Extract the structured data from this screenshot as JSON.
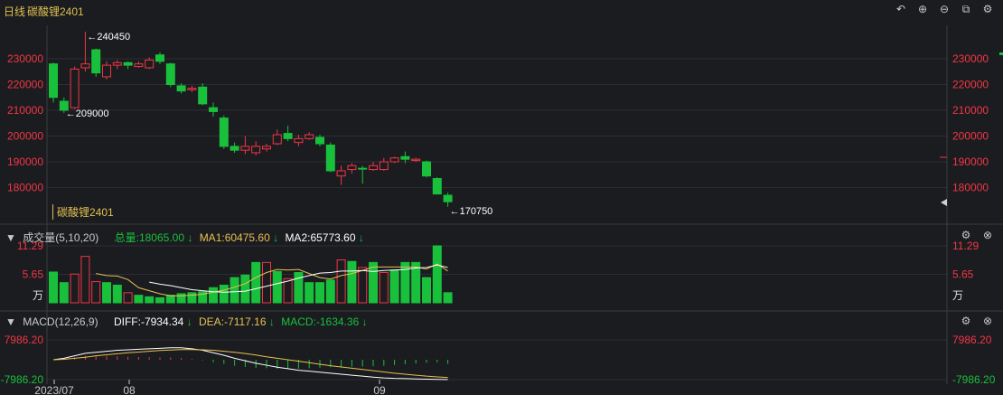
{
  "header": {
    "period": "日线",
    "instrument": "碳酸锂2401",
    "tools": [
      "undo-icon",
      "zoom-in-icon",
      "zoom-out-icon",
      "export-icon",
      "settings-icon"
    ]
  },
  "price_panel": {
    "watermark": "碳酸锂2401",
    "y_ticks": [
      "230000",
      "220000",
      "210000",
      "200000",
      "190000",
      "180000"
    ],
    "annotations": {
      "high": "240450",
      "low1": "209000",
      "low2": "170750"
    }
  },
  "volume_panel": {
    "label": "成交量(5,10,20)",
    "total_label": "总量:18065.00",
    "ma1_label": "MA1:60475.60",
    "ma2_label": "MA2:65773.60",
    "y_ticks": [
      "11.29",
      "5.65"
    ],
    "unit": "万"
  },
  "macd_panel": {
    "label": "MACD(12,26,9)",
    "diff_label": "DIFF:-7934.34",
    "dea_label": "DEA:-7117.16",
    "macd_label": "MACD:-1634.36",
    "y_ticks": [
      "7986.20",
      "-7986.20"
    ]
  },
  "x_axis": {
    "labels": [
      "2023/07",
      "08",
      "09"
    ]
  },
  "colors": {
    "up": "#f23645",
    "down": "#19c03c",
    "ma1": "#e8c050",
    "ma2": "#ffffff",
    "accent": "#e0c050"
  },
  "chart_data": [
    {
      "type": "candlestick",
      "title": "碳酸锂2401",
      "ylim": [
        170000,
        240450
      ],
      "candles": [
        [
          228000,
          215000,
          228500,
          213000
        ],
        [
          213500,
          210000,
          215000,
          209000
        ],
        [
          211000,
          226000,
          227000,
          210500
        ],
        [
          226500,
          228000,
          240450,
          225000
        ],
        [
          233500,
          224500,
          234000,
          223000
        ],
        [
          223000,
          227500,
          229000,
          222000
        ],
        [
          227500,
          228500,
          229500,
          226000
        ],
        [
          228500,
          227500,
          229000,
          226000
        ],
        [
          227000,
          228000,
          229000,
          226500
        ],
        [
          226500,
          229500,
          230500,
          226000
        ],
        [
          231500,
          229000,
          232500,
          228000
        ],
        [
          228000,
          220000,
          228500,
          219000
        ],
        [
          219500,
          217500,
          220500,
          216500
        ],
        [
          218000,
          218500,
          219500,
          217000
        ],
        [
          219000,
          212500,
          220500,
          212000
        ],
        [
          211000,
          209500,
          213000,
          207500
        ],
        [
          207000,
          196000,
          208000,
          195000
        ],
        [
          196000,
          194500,
          197500,
          193500
        ],
        [
          194500,
          196000,
          200000,
          193000
        ],
        [
          193500,
          196000,
          198000,
          192500
        ],
        [
          195000,
          196000,
          197000,
          194000
        ],
        [
          197000,
          200500,
          202500,
          196500
        ],
        [
          201000,
          199000,
          204000,
          198000
        ],
        [
          197500,
          199000,
          200500,
          196000
        ],
        [
          199000,
          200500,
          201500,
          198500
        ],
        [
          199500,
          197000,
          200500,
          196000
        ],
        [
          196500,
          186500,
          197500,
          186000
        ],
        [
          184500,
          186500,
          188500,
          181000
        ],
        [
          187000,
          188500,
          189500,
          185500
        ],
        [
          187500,
          187500,
          188500,
          181500
        ],
        [
          187000,
          188500,
          190000,
          186500
        ],
        [
          187000,
          190000,
          191500,
          186500
        ],
        [
          190000,
          191500,
          192000,
          189500
        ],
        [
          192000,
          191000,
          194000,
          189500
        ],
        [
          190500,
          191000,
          191500,
          190000
        ],
        [
          190000,
          184500,
          190500,
          184000
        ],
        [
          183500,
          177500,
          184000,
          177500
        ],
        [
          177000,
          174500,
          178000,
          172500
        ]
      ]
    },
    {
      "type": "bar",
      "title": "成交量(5,10,20)",
      "ylim": [
        0,
        11.29
      ],
      "values": [
        6.1,
        4.0,
        5.7,
        9.2,
        4.2,
        4.0,
        3.5,
        2.0,
        1.5,
        1.2,
        1.0,
        1.5,
        1.8,
        2.0,
        2.2,
        3.0,
        3.5,
        5.0,
        5.5,
        8.0,
        8.0,
        6.2,
        4.8,
        6.0,
        4.0,
        4.0,
        4.5,
        8.5,
        8.2,
        7.0,
        8.0,
        6.0,
        6.5,
        8.0,
        8.0,
        5.0,
        11.29,
        2.0
      ],
      "up": [
        false,
        false,
        true,
        true,
        true,
        false,
        false,
        true,
        false,
        false,
        false,
        false,
        false,
        false,
        false,
        false,
        false,
        false,
        false,
        false,
        true,
        false,
        true,
        false,
        false,
        false,
        false,
        true,
        false,
        true,
        false,
        true,
        false,
        false,
        false,
        false,
        false,
        false
      ],
      "series": [
        {
          "name": "MA1",
          "values": [
            null,
            null,
            null,
            null,
            5.8,
            5.4,
            5.3,
            4.6,
            3.0,
            2.4,
            1.8,
            1.4,
            1.4,
            1.5,
            1.7,
            2.1,
            2.5,
            3.1,
            3.8,
            5.0,
            6.0,
            6.6,
            6.5,
            6.6,
            5.8,
            5.0,
            4.7,
            5.4,
            5.8,
            6.4,
            7.1,
            7.1,
            7.1,
            7.1,
            7.1,
            6.7,
            7.7,
            6.3
          ]
        },
        {
          "name": "MA2",
          "values": [
            null,
            null,
            null,
            null,
            null,
            null,
            null,
            null,
            null,
            4.1,
            3.7,
            3.4,
            3.0,
            2.6,
            2.4,
            2.2,
            2.1,
            2.2,
            2.3,
            2.8,
            3.3,
            3.8,
            4.3,
            4.9,
            5.4,
            5.9,
            6.0,
            6.3,
            6.3,
            6.4,
            6.2,
            6.4,
            6.5,
            6.6,
            6.9,
            7.0,
            7.5,
            7.0
          ]
        }
      ]
    },
    {
      "type": "line",
      "title": "MACD(12,26,9)",
      "ylim": [
        -7986.2,
        7986.2
      ],
      "series": [
        {
          "name": "DIFF",
          "values": [
            0,
            600,
            1600,
            2600,
            3000,
            3400,
            3800,
            4000,
            4200,
            4400,
            4600,
            4800,
            4800,
            4400,
            3800,
            2800,
            1800,
            600,
            -400,
            -1400,
            -2200,
            -3000,
            -3600,
            -4200,
            -4600,
            -5000,
            -5400,
            -5800,
            -6200,
            -6600,
            -7000,
            -7300,
            -7500,
            -7600,
            -7700,
            -7800,
            -7900,
            -7934.34
          ]
        },
        {
          "name": "DEA",
          "values": [
            0,
            200,
            600,
            1000,
            1600,
            2000,
            2400,
            2800,
            3100,
            3400,
            3700,
            3900,
            4100,
            4100,
            4000,
            3800,
            3400,
            3000,
            2500,
            1900,
            1200,
            600,
            0,
            -600,
            -1200,
            -1800,
            -2400,
            -2900,
            -3400,
            -3900,
            -4400,
            -4900,
            -5400,
            -5800,
            -6200,
            -6600,
            -6900,
            -7117.16
          ]
        },
        {
          "name": "MACD",
          "values": [
            0,
            400,
            1000,
            1600,
            1400,
            1400,
            1400,
            1200,
            1100,
            1000,
            900,
            900,
            700,
            300,
            -200,
            -1000,
            -1600,
            -2400,
            -2900,
            -3300,
            -3400,
            -3600,
            -3600,
            -3600,
            -3400,
            -3200,
            -3000,
            -2900,
            -2800,
            -2700,
            -2600,
            -2400,
            -2100,
            -1800,
            -1500,
            -1200,
            -1000,
            -1634.36
          ]
        }
      ]
    }
  ]
}
